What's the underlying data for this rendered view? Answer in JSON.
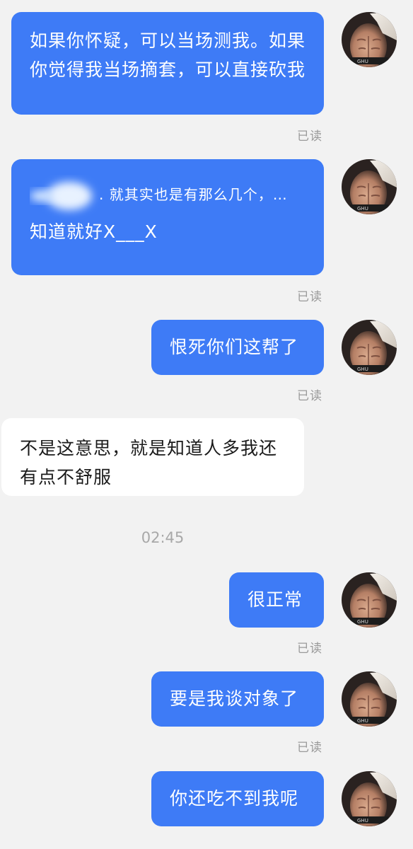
{
  "messages": [
    {
      "id": "m1",
      "direction": "outgoing",
      "text": "如果你怀疑，可以当场测我。如果你觉得我当场摘套，可以直接砍我",
      "status": "已读"
    },
    {
      "id": "m2",
      "direction": "outgoing",
      "quote": ". 就其实也是有那么几个，…",
      "text": "知道就好X___X",
      "status": "已读"
    },
    {
      "id": "m3",
      "direction": "outgoing",
      "text": "恨死你们这帮了",
      "status": "已读"
    },
    {
      "id": "m4",
      "direction": "incoming",
      "text": "不是这意思，就是知道人多我还有点不舒服"
    },
    {
      "id": "m5",
      "direction": "outgoing",
      "text": "很正常",
      "status": "已读"
    },
    {
      "id": "m6",
      "direction": "outgoing",
      "text": "要是我谈对象了",
      "status": "已读"
    },
    {
      "id": "m7",
      "direction": "outgoing",
      "text": "你还吃不到我呢"
    }
  ],
  "timestamp": "02:45",
  "colors": {
    "outgoing_bubble": "#3e7bf6",
    "incoming_bubble": "#ffffff",
    "background": "#f2f2f2",
    "read_status": "#9a9a9a"
  },
  "icons": {
    "avatar": "user-avatar-photo"
  }
}
